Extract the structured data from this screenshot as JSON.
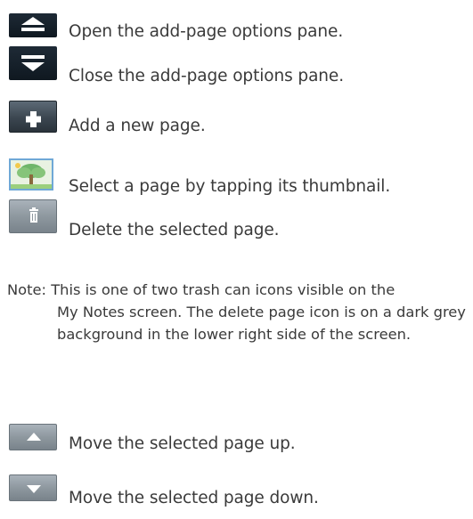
{
  "items": [
    {
      "icon": "open-pane-icon",
      "label": "Open the add-page options pane."
    },
    {
      "icon": "close-pane-icon",
      "label": "Close the add-page options pane."
    },
    {
      "icon": "plus-icon",
      "label": "Add a new page."
    },
    {
      "icon": "page-thumbnail-icon",
      "label": "Select a page by tapping its thumbnail."
    },
    {
      "icon": "trash-icon",
      "label": "Delete the selected page."
    },
    {
      "icon": "arrow-up-icon",
      "label": "Move the selected page up."
    },
    {
      "icon": "arrow-down-icon",
      "label": "Move the selected page down."
    }
  ],
  "note": {
    "prefix": "Note: ",
    "first_line": "This is one of two trash can icons visible on the",
    "rest": "My Notes screen. The delete page icon is on a dark grey background in the lower right side of the screen."
  },
  "colors": {
    "text": "#3a3a3a",
    "dark_button": "#1e2a36",
    "grey_button": "#8e989f",
    "thumb_border": "#6fa8d6"
  }
}
